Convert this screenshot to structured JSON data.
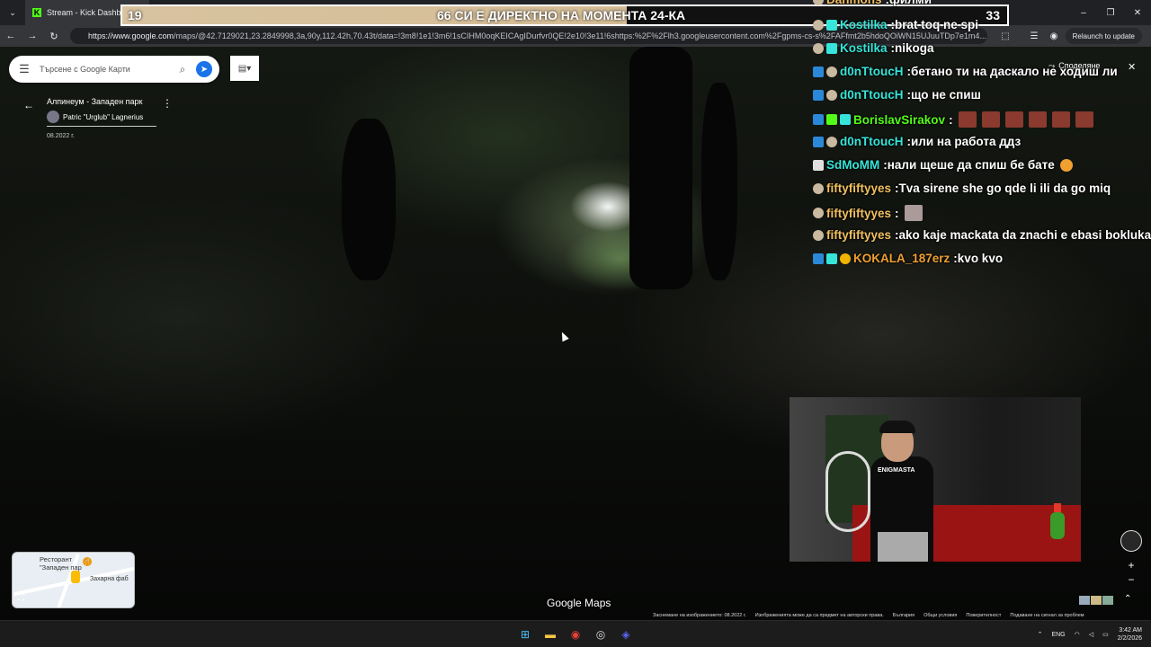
{
  "browser": {
    "tab_title": "Stream - Kick Dashboard",
    "url_host": "https://www.google.com",
    "url_rest": "/maps/@42.7129021,23.2849998,3a,90y,112.42h,70.43t/data=!3m8!1e1!3m6!1sCIHM0oqKEICAgIDurfvr0QE!2e10!3e11!6shttps:%2F%2Flh3.googleusercontent.com%2Fgpms-cs-s%2FAFfmt2b5hdoQOiWN15UJuuTDp7e1m4...",
    "relaunch_label": "Relaunch to update"
  },
  "banner": {
    "left_number": "19",
    "text": "66 СИ Е ДИРЕКТНО НА МОМЕНТА 24-КА",
    "right_number": "33"
  },
  "maps": {
    "search_placeholder": "Търсене с Google Карти",
    "place_title": "Алпинеум - Западен парк",
    "author": "Patric \"Urglub\" Lagnerius",
    "date": "08.2022 г.",
    "share_label": "Споделяне",
    "logo": "Google Maps",
    "minimap_label1": "Ресторант\n\"Западен пар",
    "minimap_label2": "Захарна фаб",
    "footer": [
      "Заснемане на изображението: 08.2022 г.",
      "Изображенията може да са предмет на авторски права.",
      "България",
      "Общи условия",
      "Поверителност",
      "Подаване на сигнал за проблем"
    ]
  },
  "chat": {
    "messages": [
      {
        "user": "Danmons",
        "text": "филми",
        "color": "#f0c060",
        "badges": [
          "face"
        ],
        "emotes": 0
      },
      {
        "user": "Kostilka",
        "text": "brat toq ne spi",
        "color": "#36e4d9",
        "badges": [
          "face",
          "sub"
        ],
        "emotes": 0
      },
      {
        "user": "Kostilka",
        "text": "nikoga",
        "color": "#36e4d9",
        "badges": [
          "face",
          "sub"
        ],
        "emotes": 0
      },
      {
        "user": "d0nTtoucH",
        "text": "бетано ти на даскало не ходиш ли",
        "color": "#36e4d9",
        "badges": [
          "prime",
          "face"
        ],
        "emotes": 0
      },
      {
        "user": "d0nTtoucH",
        "text": "що не спиш",
        "color": "#36e4d9",
        "badges": [
          "prime",
          "face"
        ],
        "emotes": 0
      },
      {
        "user": "BorislavSirakov",
        "text": "",
        "color": "#53fc18",
        "badges": [
          "prime",
          "green",
          "sub"
        ],
        "emotes": 6
      },
      {
        "user": "d0nTtoucH",
        "text": "или на работа ддз",
        "color": "#36e4d9",
        "badges": [
          "prime",
          "face"
        ],
        "emotes": 0
      },
      {
        "user": "SdMoMM",
        "text": "нали щеше да спиш бе бате",
        "color": "#36e4d9",
        "badges": [
          "mod"
        ],
        "emotes": 0,
        "smiley": true
      },
      {
        "user": "fiftyfiftyyes",
        "text": "Tva sirene she go qde li ili da go miq",
        "color": "#f0c060",
        "badges": [
          "face"
        ],
        "emotes": 0
      },
      {
        "user": "fiftyfiftyyes",
        "text": "",
        "color": "#f0c060",
        "badges": [
          "face"
        ],
        "emotes": 1,
        "cat": true
      },
      {
        "user": "fiftyfiftyyes",
        "text": "ako kaje mackata da znachi e ebasi bokluka",
        "color": "#f0c060",
        "badges": [
          "face"
        ],
        "emotes": 0
      },
      {
        "user": "KOKALA_187erz",
        "text": "kvo kvo",
        "color": "#f0a030",
        "badges": [
          "prime",
          "sub",
          "gift"
        ],
        "emotes": 0
      }
    ]
  },
  "webcam": {
    "shirt_text": "ENIGMASTA"
  },
  "taskbar": {
    "lang": "ENG",
    "time": "3:42 AM",
    "date": "2/2/2026"
  }
}
